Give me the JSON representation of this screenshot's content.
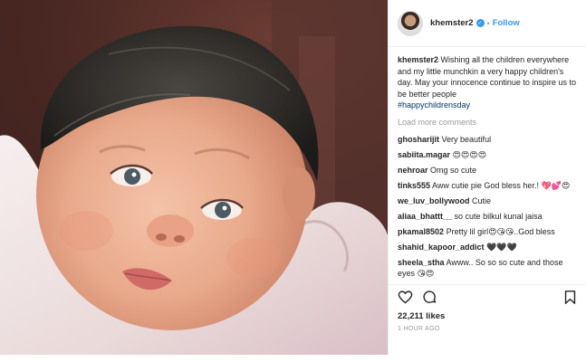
{
  "post": {
    "image_alt": "baby photo",
    "author": {
      "username": "khemster2",
      "verified_icon": "verified-badge-icon",
      "separator": "•",
      "follow_label": "Follow"
    },
    "caption": {
      "username": "khemster2",
      "text": "Wishing all the children everywhere and my little munchkin a very happy children's day. May your innocence continue to inspire us to be better people",
      "hashtag": "#happychildrensday"
    },
    "load_more_label": "Load more comments",
    "comments": [
      {
        "username": "ghosharijit",
        "text": "Very beautiful"
      },
      {
        "username": "sabiita.magar",
        "text": "😍😍😍😍"
      },
      {
        "username": "nehroar",
        "text": "Omg so cute"
      },
      {
        "username": "tinks555",
        "text": "Aww cutie pie God bless her.! 💖💕😍"
      },
      {
        "username": "we_luv_bollywood",
        "text": "Cutie"
      },
      {
        "username": "aliaa_bhattt__",
        "text": "so cute bilkul kunal jaisa"
      },
      {
        "username": "pkamal8502",
        "text": "Pretty lil girl😍😘😘..God bless"
      },
      {
        "username": "shahid_kapoor_addict",
        "text": "🖤🖤🖤"
      },
      {
        "username": "sheela_stha",
        "text": "Awww.. So so so cute and those eyes 😘😍"
      }
    ],
    "actions": {
      "like_icon": "heart-outline-icon",
      "comment_icon": "comment-bubble-icon",
      "save_icon": "bookmark-icon"
    },
    "likes": "22,211 likes",
    "timestamp": "1 HOUR AGO"
  },
  "colors": {
    "link_blue": "#3897f0",
    "hashtag": "#003569",
    "muted": "#999999",
    "text": "#262626"
  }
}
